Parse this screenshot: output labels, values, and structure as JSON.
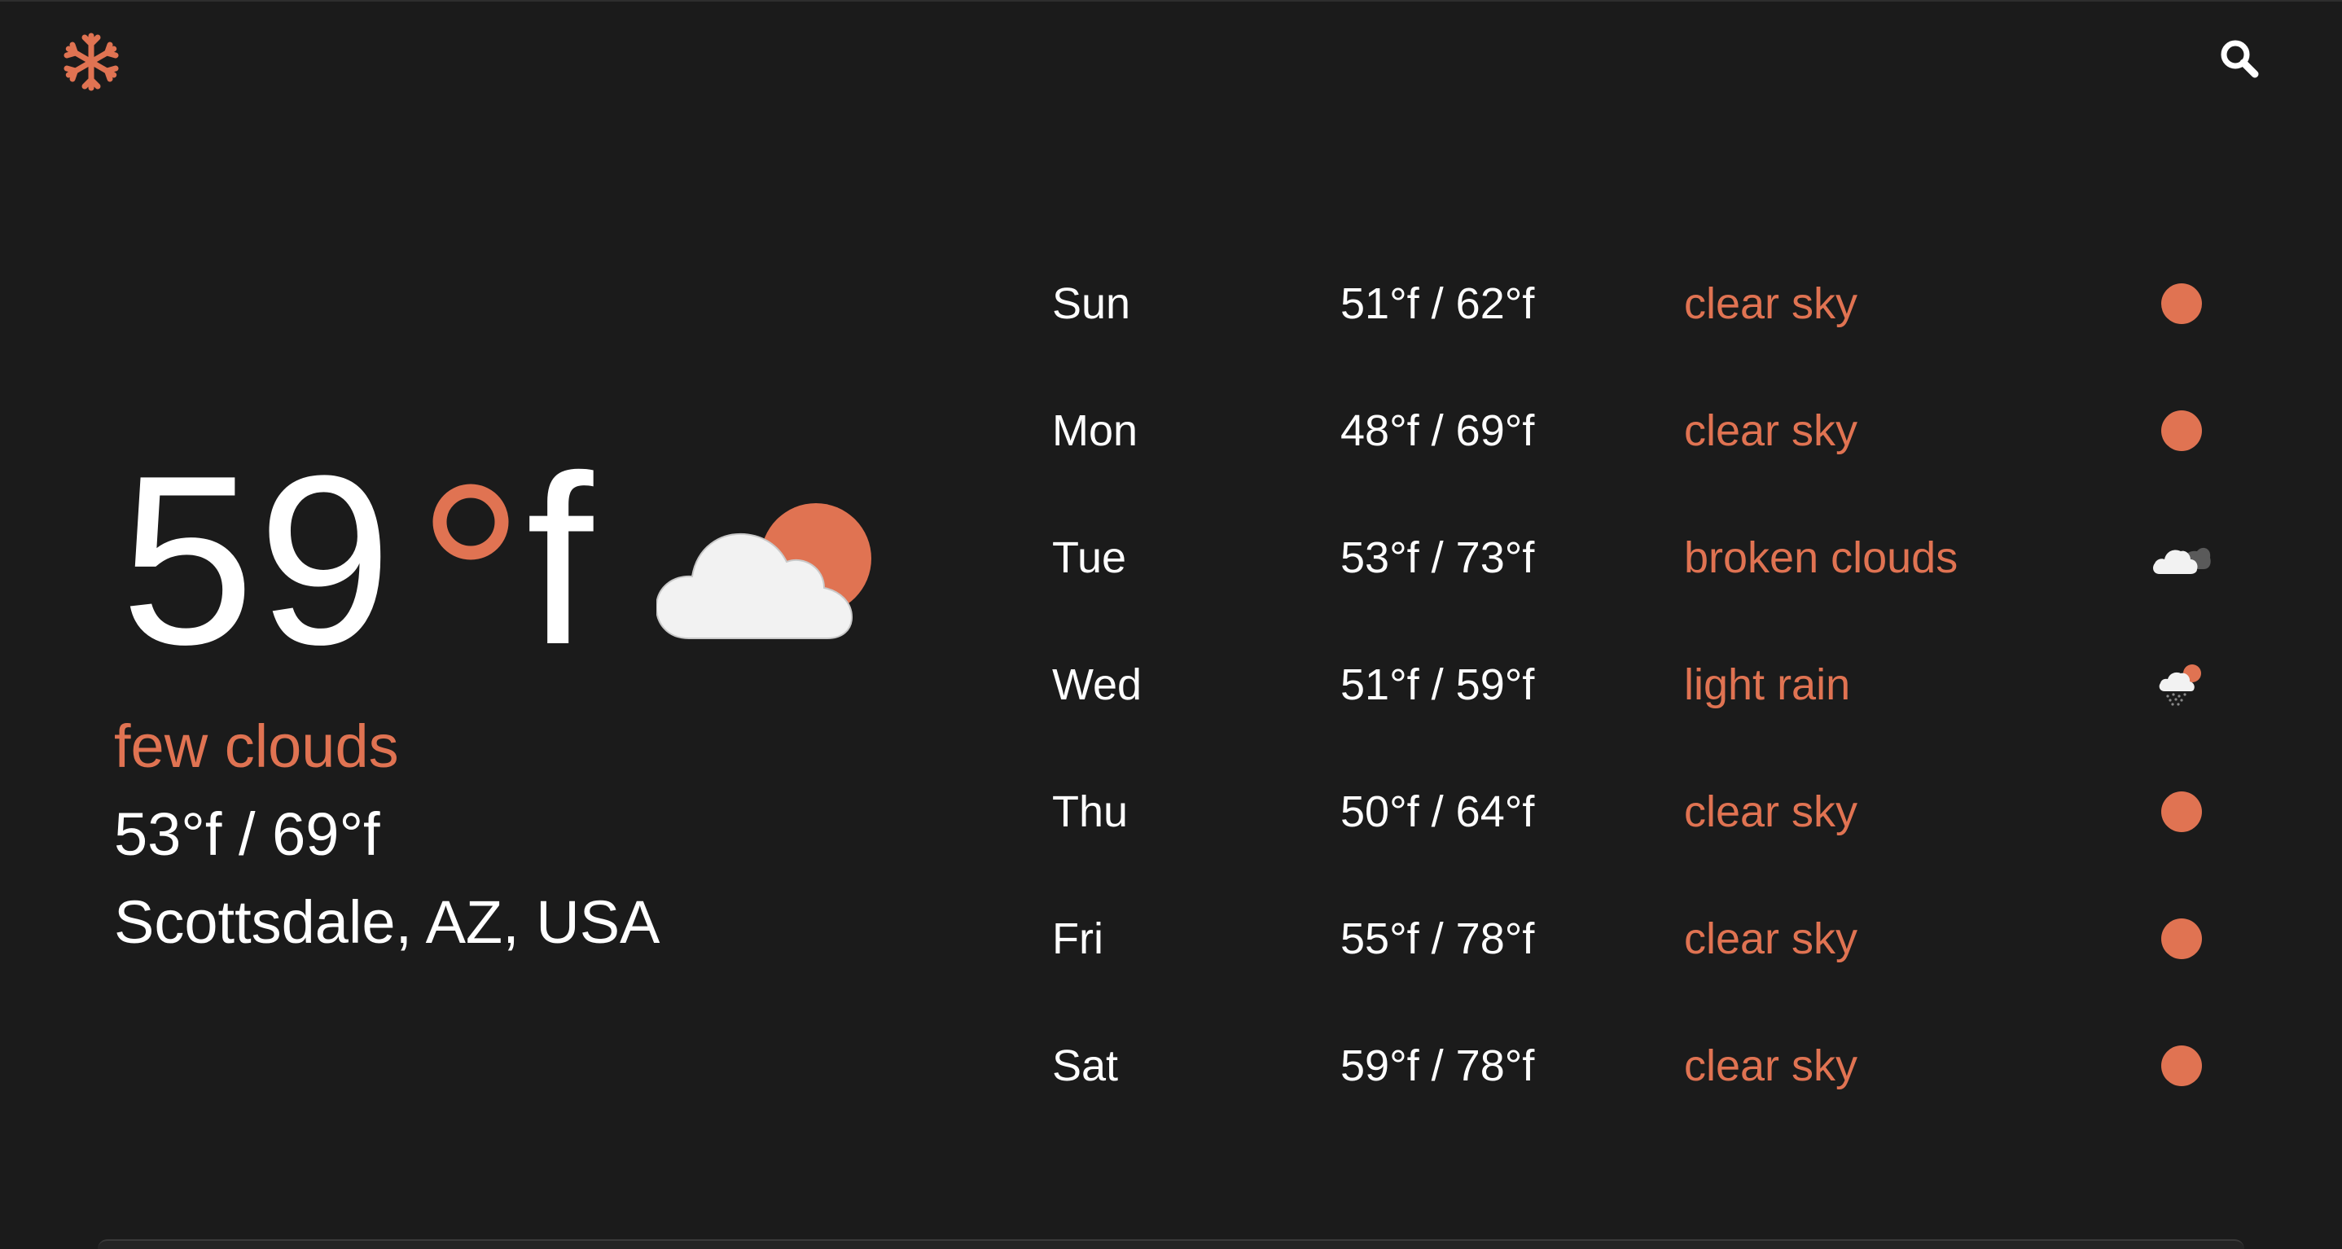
{
  "header": {
    "logo_icon": "snowflake-icon",
    "search_icon": "search-icon"
  },
  "colors": {
    "background": "#1b1b1b",
    "accent": "#e07352",
    "text": "#ffffff",
    "cloud": "#f2f2f2"
  },
  "current": {
    "temperature": "59",
    "unit": "f",
    "icon": "few-clouds-icon",
    "description": "few clouds",
    "range": "53°f / 69°f",
    "location": "Scottsdale, AZ, USA"
  },
  "forecast": [
    {
      "day": "Sun",
      "range": "51°f / 62°f",
      "description": "clear sky",
      "icon": "clear-sky-icon"
    },
    {
      "day": "Mon",
      "range": "48°f / 69°f",
      "description": "clear sky",
      "icon": "clear-sky-icon"
    },
    {
      "day": "Tue",
      "range": "53°f / 73°f",
      "description": "broken clouds",
      "icon": "broken-clouds-icon"
    },
    {
      "day": "Wed",
      "range": "51°f / 59°f",
      "description": "light rain",
      "icon": "light-rain-icon"
    },
    {
      "day": "Thu",
      "range": "50°f / 64°f",
      "description": "clear sky",
      "icon": "clear-sky-icon"
    },
    {
      "day": "Fri",
      "range": "55°f / 78°f",
      "description": "clear sky",
      "icon": "clear-sky-icon"
    },
    {
      "day": "Sat",
      "range": "59°f / 78°f",
      "description": "clear sky",
      "icon": "clear-sky-icon"
    }
  ]
}
